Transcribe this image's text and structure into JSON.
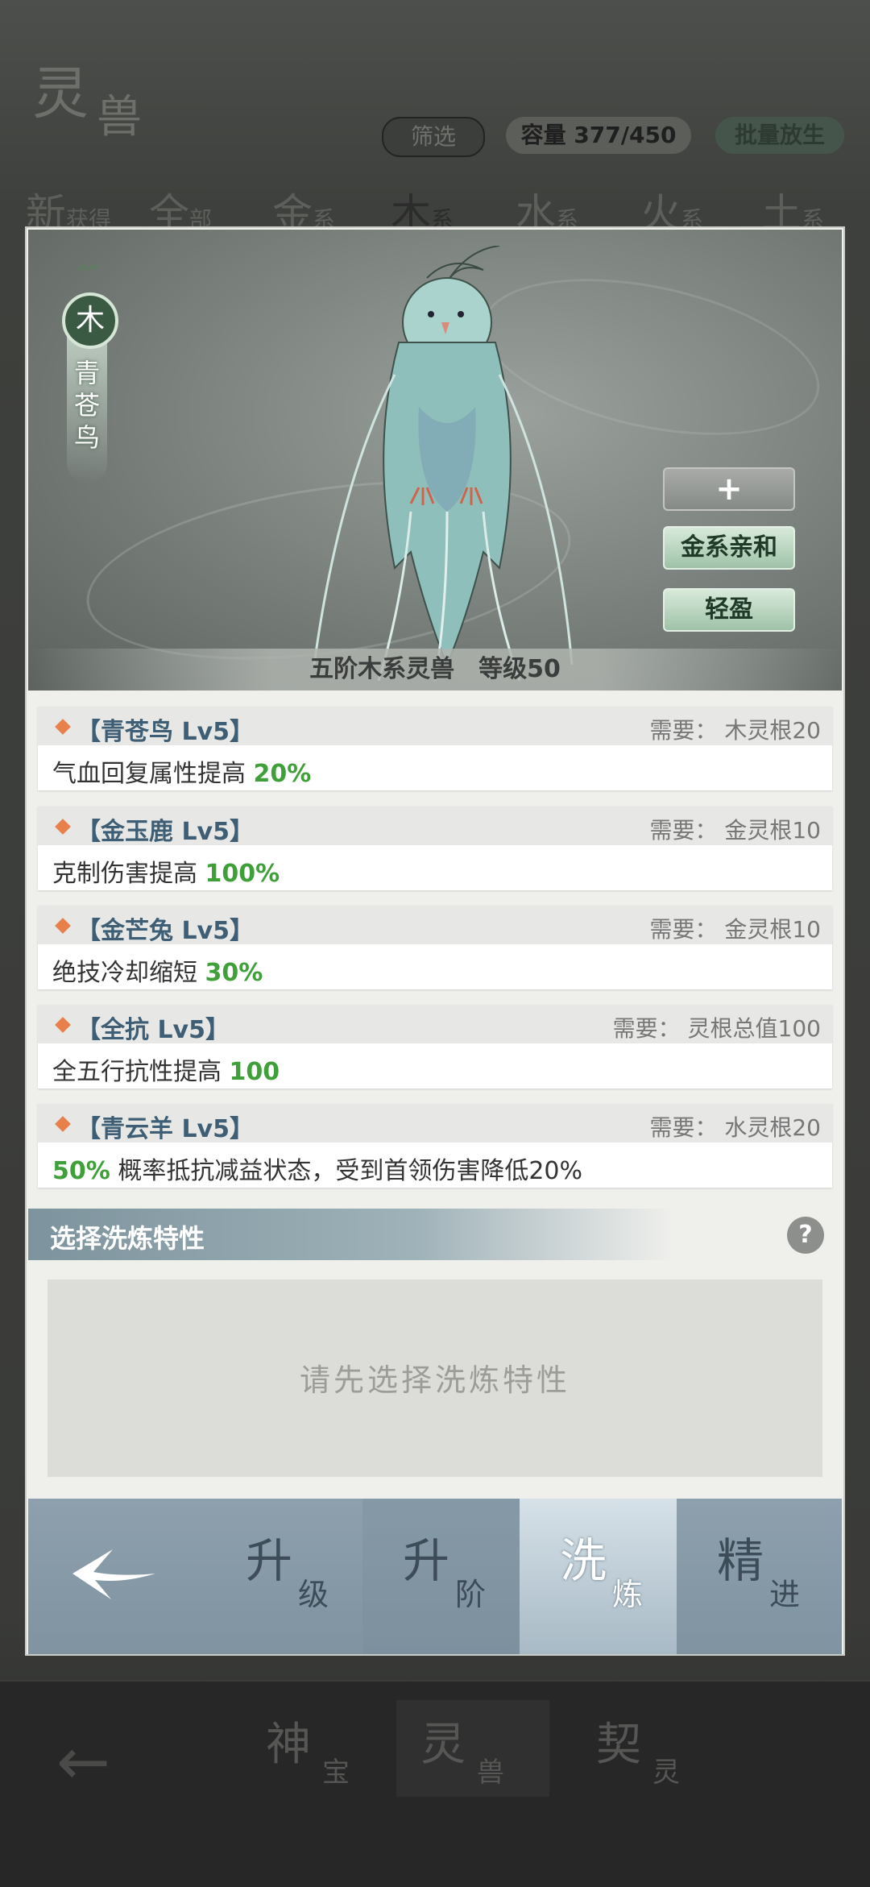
{
  "background": {
    "logo": {
      "main": "灵",
      "second": "兽"
    },
    "filter_label": "筛选",
    "capacity_label": "容量 377/450",
    "release_label": "批量放生",
    "tabs": [
      {
        "big": "新",
        "small": "获得"
      },
      {
        "big": "全",
        "small": "部"
      },
      {
        "big": "金",
        "small": "系"
      },
      {
        "big": "木",
        "small": "系"
      },
      {
        "big": "水",
        "small": "系"
      },
      {
        "big": "火",
        "small": "系"
      },
      {
        "big": "土",
        "small": "系"
      }
    ],
    "bottom_nav": [
      {
        "big": "神",
        "small": "宝"
      },
      {
        "big": "灵",
        "small": "兽"
      },
      {
        "big": "契",
        "small": "灵"
      }
    ]
  },
  "hero": {
    "element": "木",
    "name": "青苍鸟",
    "caption": "五阶木系灵兽　等级50",
    "plus_label": "+",
    "trait_buttons": [
      "金系亲和",
      "轻盈"
    ]
  },
  "traits": [
    {
      "name": "【青苍鸟 Lv5】",
      "requirement": "需要：  木灵根20",
      "desc_before": "气血回复属性提高 ",
      "desc_highlight": "20%",
      "desc_after": ""
    },
    {
      "name": "【金玉鹿 Lv5】",
      "requirement": "需要：  金灵根10",
      "desc_before": "克制伤害提高 ",
      "desc_highlight": "100%",
      "desc_after": ""
    },
    {
      "name": "【金芒兔 Lv5】",
      "requirement": "需要：  金灵根10",
      "desc_before": "绝技冷却缩短 ",
      "desc_highlight": "30%",
      "desc_after": ""
    },
    {
      "name": "【全抗 Lv5】",
      "requirement": "需要：  灵根总值100",
      "desc_before": "全五行抗性提高 ",
      "desc_highlight": "100",
      "desc_after": ""
    },
    {
      "name": "【青云羊 Lv5】",
      "requirement": "需要：  水灵根20",
      "desc_before": "",
      "desc_highlight": "50%",
      "desc_after": " 概率抵抗减益状态，受到首领伤害降低20%"
    }
  ],
  "wash": {
    "title": "选择洗炼特性",
    "help": "?",
    "placeholder": "请先选择洗炼特性"
  },
  "tabs": [
    {
      "big": "升",
      "small": "级"
    },
    {
      "big": "升",
      "small": "阶"
    },
    {
      "big": "洗",
      "small": "炼"
    },
    {
      "big": "精",
      "small": "进"
    }
  ]
}
